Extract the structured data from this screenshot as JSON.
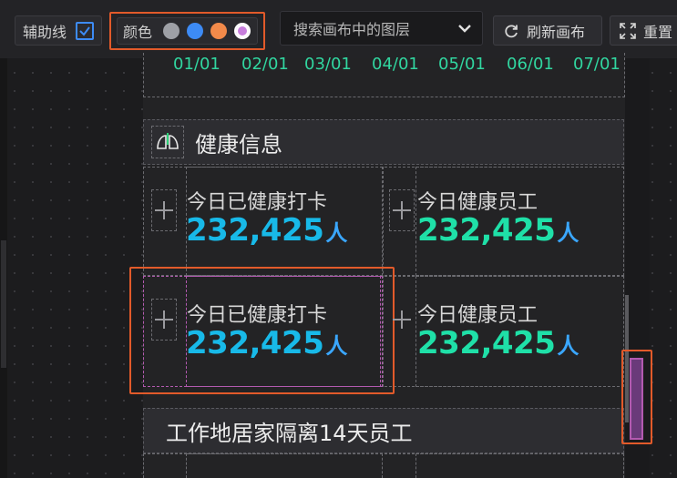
{
  "toolbar": {
    "assist_label": "辅助线",
    "assist_checked": true,
    "color_label": "颜色",
    "color_swatches": [
      "#9ea0a6",
      "#3d8bf5",
      "#f28a4a",
      "#c77ddc"
    ],
    "selected_swatch": 3,
    "layer_search_placeholder": "搜索画布中的图层",
    "refresh_label": "刷新画布",
    "reset_label": "重置"
  },
  "canvas": {
    "dates": [
      "01/01",
      "02/01",
      "03/01",
      "04/01",
      "05/01",
      "06/01",
      "07/01"
    ],
    "section1_title": "健康信息",
    "cards": [
      {
        "label": "今日已健康打卡",
        "value": "232,425",
        "unit": "人",
        "color": "#18b9e8"
      },
      {
        "label": "今日健康员工",
        "value": "232,425",
        "unit": "人",
        "color": "#1fe0a8"
      },
      {
        "label": "今日已健康打卡",
        "value": "232,425",
        "unit": "人",
        "color": "#18b9e8"
      },
      {
        "label": "今日健康员工",
        "value": "232,425",
        "unit": "人",
        "color": "#1fe0a8"
      }
    ],
    "section2_title": "工作地居家隔离14天员工"
  },
  "colors": {
    "accent_orange": "#e25a2a",
    "date_green": "#31d6a0",
    "unit_blue": "#3aa7ff"
  }
}
